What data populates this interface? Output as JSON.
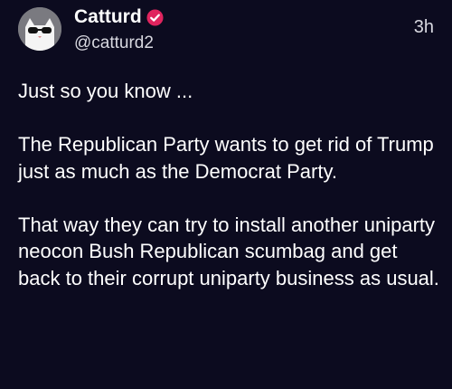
{
  "tweet": {
    "author": {
      "display_name": "Catturd",
      "handle": "@catturd2",
      "verified": true,
      "verified_badge_color": "#e0245e",
      "avatar_icon": "cat-with-sunglasses-avatar"
    },
    "timestamp": "3h",
    "paragraphs": [
      "Just so you know ...",
      "The Republican Party wants to get rid of Trump just as much as the Democrat Party.",
      "That way they can try to install another uniparty neocon Bush Republican scumbag and get back to their corrupt uniparty business as usual."
    ]
  },
  "colors": {
    "background": "#0c0b1f",
    "text": "#ffffff",
    "secondary_text": "#d8d8e0"
  }
}
